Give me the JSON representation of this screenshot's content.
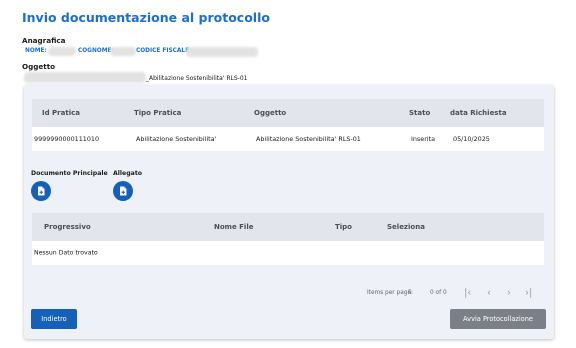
{
  "page": {
    "title": "Invio documentazione al protocollo"
  },
  "anagrafica": {
    "label": "Anagrafica",
    "nome_label": "NOME:",
    "cognome_label": "COGNOME:",
    "codice_fiscale_label": "CODICE FISCALE:"
  },
  "oggetto": {
    "label": "Oggetto",
    "value": "_Abilitazione Sostenibilita' RLS-01"
  },
  "pratiche_table": {
    "headers": [
      "Id Pratica",
      "Tipo Pratica",
      "Oggetto",
      "Stato",
      "data Richiesta"
    ],
    "rows": [
      [
        "9999990000111010",
        "Abilitazione Sostenibilita'",
        "Abilitazione Sostenibilita' RLS-01",
        "Inserita",
        "05/10/2025"
      ]
    ]
  },
  "documenti": {
    "principale_label": "Documento Principale",
    "allegato_label": "Allegato",
    "icon": "file-add-icon"
  },
  "files_table": {
    "headers": [
      "Progressivo",
      "Nome File",
      "Tipo",
      "Seleziona"
    ],
    "empty_text": "Nessun Dato trovato"
  },
  "paginator": {
    "items_per_page_label": "Items per page:",
    "items_per_page_value": "5",
    "range": "0 of 0",
    "icons": [
      "first-page-icon",
      "prev-page-icon",
      "next-page-icon",
      "last-page-icon"
    ]
  },
  "actions": {
    "back_label": "Indietro",
    "submit_label": "Avvia Protocollazione"
  },
  "colors": {
    "accent": "#1a6fcf",
    "primary_button": "#1560b8",
    "disabled_button": "#7b8088",
    "header_row": "#e2e6ec",
    "card_bg": "#eef2f8"
  }
}
